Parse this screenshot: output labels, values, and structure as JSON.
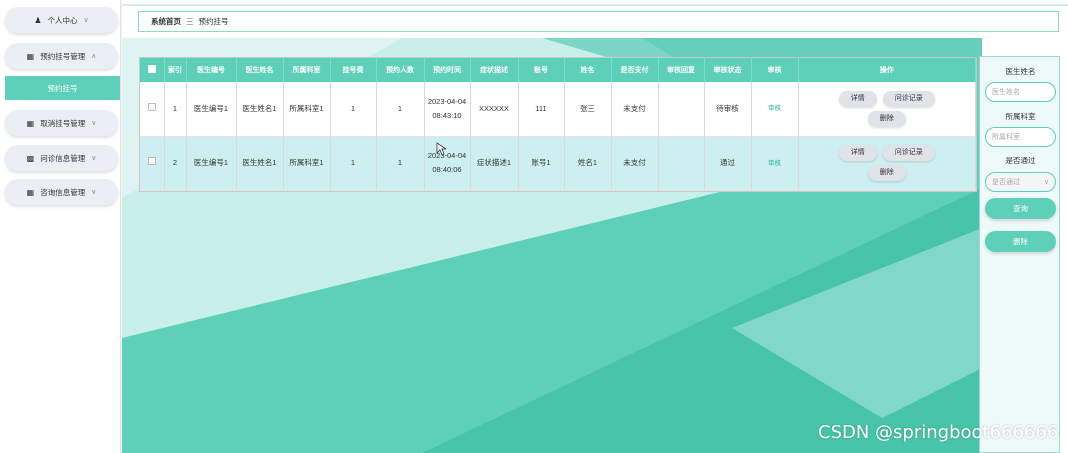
{
  "sidebar": {
    "items": [
      {
        "label": "个人中心",
        "icon": "user-icon",
        "chevron": "chevron-down-icon"
      },
      {
        "label": "预约挂号管理",
        "icon": "grid-icon",
        "chevron": "chevron-up-icon"
      },
      {
        "label": "预约挂号",
        "icon": "",
        "chevron": ""
      },
      {
        "label": "取消挂号管理",
        "icon": "grid-icon",
        "chevron": "chevron-down-icon"
      },
      {
        "label": "问诊信息管理",
        "icon": "chart-icon",
        "chevron": "chevron-down-icon"
      },
      {
        "label": "咨询信息管理",
        "icon": "grid-icon",
        "chevron": "chevron-down-icon"
      }
    ]
  },
  "breadcrumb": {
    "home": "系统首页",
    "separator": "三",
    "current": "预约挂号"
  },
  "table": {
    "headers": [
      "索引",
      "医生编号",
      "医生姓名",
      "所属科室",
      "挂号费",
      "预约人数",
      "预约时间",
      "症状描述",
      "账号",
      "姓名",
      "是否支付",
      "审核回复",
      "审核状态",
      "审核",
      "操作"
    ],
    "rows": [
      {
        "index": "1",
        "doctor_no": "医生编号1",
        "doctor_name": "医生姓名1",
        "dept": "所属科室1",
        "fee": "1",
        "count": "1",
        "time": "2023-04-04 08:43:10",
        "symptom": "XXXXXX",
        "account": "111",
        "name": "张三",
        "paid": "未支付",
        "reply": "",
        "status": "待审核",
        "audit": "审核"
      },
      {
        "index": "2",
        "doctor_no": "医生编号1",
        "doctor_name": "医生姓名1",
        "dept": "所属科室1",
        "fee": "1",
        "count": "1",
        "time": "2023-04-04 08:40:06",
        "symptom": "症状描述1",
        "account": "账号1",
        "name": "姓名1",
        "paid": "未支付",
        "reply": "",
        "status": "通过",
        "audit": "审核"
      }
    ],
    "op_buttons": {
      "detail": "详情",
      "record": "问诊记录",
      "delete": "删除"
    }
  },
  "search": {
    "doctor_name_label": "医生姓名",
    "doctor_name_placeholder": "医生姓名",
    "dept_label": "所属科室",
    "dept_placeholder": "所属科室",
    "passed_label": "是否通过",
    "passed_placeholder": "是否通过",
    "query_button": "查询",
    "delete_button": "删除"
  },
  "watermark": "CSDN @springboot666666",
  "colors": {
    "accent": "#5ecfb8",
    "row_alt": "#cdeff1"
  }
}
